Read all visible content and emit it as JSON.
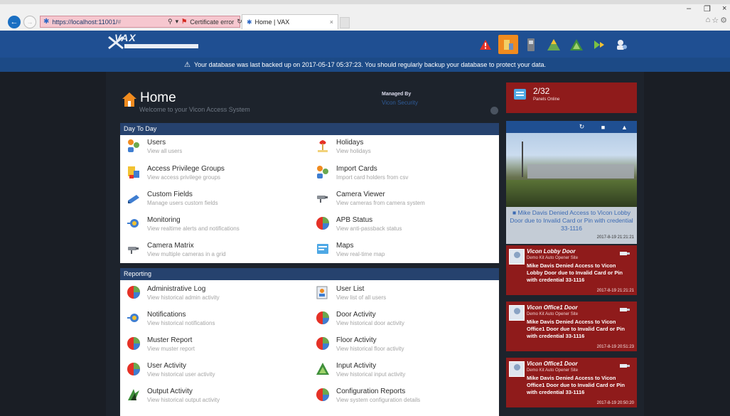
{
  "browser": {
    "url_host": "https://localhost:11001/",
    "url_dim": "#",
    "cert": "Certificate error",
    "tab_title": "Home | VAX",
    "tab_close": "×",
    "win_min": "–",
    "win_max": "❐",
    "win_close": "×"
  },
  "logo": {
    "word": "VAX"
  },
  "banner": {
    "text": "Your database was last backed up on 2017-05-17 05:37:23. You should regularly backup your database to protect your data."
  },
  "home": {
    "title": "Home",
    "subtitle": "Welcome to your Vicon Access System",
    "managed_label": "Managed By",
    "managed_by": "Vicon Security"
  },
  "day_to_day": {
    "heading": "Day To Day",
    "items": [
      {
        "title": "Users",
        "desc": "View all users"
      },
      {
        "title": "Holidays",
        "desc": "View holidays"
      },
      {
        "title": "Access Privilege Groups",
        "desc": "View access privilege groups"
      },
      {
        "title": "Import Cards",
        "desc": "Import card holders from csv"
      },
      {
        "title": "Custom Fields",
        "desc": "Manage users custom fields"
      },
      {
        "title": "Camera Viewer",
        "desc": "View cameras from camera system"
      },
      {
        "title": "Monitoring",
        "desc": "View realtime alerts and notifications"
      },
      {
        "title": "APB Status",
        "desc": "View anti-passback status"
      },
      {
        "title": "Camera Matrix",
        "desc": "View multiple cameras in a grid"
      },
      {
        "title": "Maps",
        "desc": "View real-time map"
      }
    ]
  },
  "reporting": {
    "heading": "Reporting",
    "items": [
      {
        "title": "Administrative Log",
        "desc": "View historical admin activity"
      },
      {
        "title": "User List",
        "desc": "View list of all users"
      },
      {
        "title": "Notifications",
        "desc": "View historical notifications"
      },
      {
        "title": "Door Activity",
        "desc": "View historical door activity"
      },
      {
        "title": "Muster Report",
        "desc": "View muster report"
      },
      {
        "title": "Floor Activity",
        "desc": "View historical floor activity"
      },
      {
        "title": "User Activity",
        "desc": "View historical user activity"
      },
      {
        "title": "Input Activity",
        "desc": "View historical input activity"
      },
      {
        "title": "Output Activity",
        "desc": "View historical output activity"
      },
      {
        "title": "Configuration Reports",
        "desc": "View system configuration details"
      }
    ]
  },
  "panels": {
    "count": "2/32",
    "label": "Panels Online"
  },
  "camera": {
    "caption": "Mike Davis Denied Access to Vicon Lobby Door due to Invalid Card or Pin with credential 33-1116",
    "timestamp": "2017-8-19 21:21:21"
  },
  "alerts": [
    {
      "door": "Vicon Lobby Door",
      "site": "Demo Kit Auto Opener Site",
      "msg": "Mike Davis Denied Access to Vicon Lobby Door due to Invalid Card or Pin with credential 33-1116",
      "ts": "2017-8-19 21:21:21"
    },
    {
      "door": "Vicon Office1 Door",
      "site": "Demo Kit Auto Opener Site",
      "msg": "Mike Davis Denied Access to Vicon Office1 Door due to Invalid Card or Pin with credential 33-1116",
      "ts": "2017-8-19 20:51:23"
    },
    {
      "door": "Vicon Office1 Door",
      "site": "Demo Kit Auto Opener Site",
      "msg": "Mike Davis Denied Access to Vicon Office1 Door due to Invalid Card or Pin with credential 33-1116",
      "ts": "2017-8-19 20:50:20"
    }
  ],
  "colors": {
    "app_bar": "#1f4f92",
    "alert_red": "#8f1b1b",
    "toolbar_selected": "#f08b1f"
  }
}
